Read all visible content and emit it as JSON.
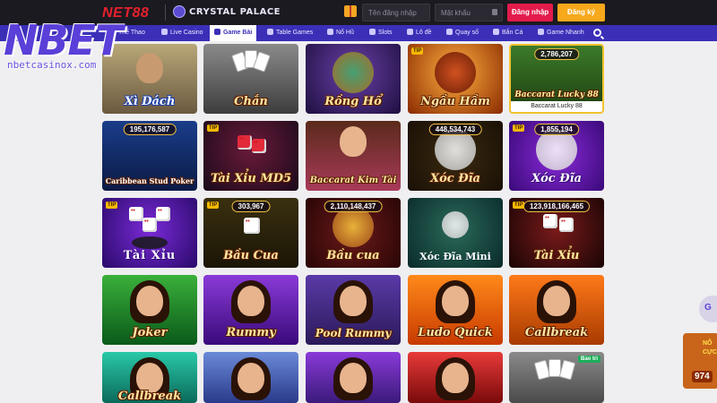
{
  "header": {
    "logo": "NET88",
    "brand": "CRYSTAL PALACE",
    "username_placeholder": "Tên đăng nhập",
    "password_placeholder": "Mật khẩu",
    "login_label": "Đăng nhập",
    "register_label": "Đăng ký"
  },
  "nav": {
    "items": [
      {
        "label": "Thể Thao",
        "icon": "ball-icon"
      },
      {
        "label": "Live Casino",
        "icon": "dealer-icon"
      },
      {
        "label": "Game Bài",
        "icon": "cards-icon",
        "active": true
      },
      {
        "label": "Table Games",
        "icon": "table-icon"
      },
      {
        "label": "Nổ Hũ",
        "icon": "jackpot-icon"
      },
      {
        "label": "Slots",
        "icon": "slot-icon"
      },
      {
        "label": "Lô đề",
        "icon": "lottery-icon"
      },
      {
        "label": "Quay số",
        "icon": "wheel-icon"
      },
      {
        "label": "Bắn Cá",
        "icon": "fish-icon"
      },
      {
        "label": "Game Nhanh",
        "icon": "rocket-icon"
      }
    ]
  },
  "watermark": {
    "main": "NBET",
    "sub": "nbetcasinox.com"
  },
  "games": [
    {
      "title": "Xì Dách"
    },
    {
      "title": "Chắn"
    },
    {
      "title": "Rồng Hổ"
    },
    {
      "title": "Ngầu Hầm",
      "badge": "TIP"
    },
    {
      "title": "Baccarat Lucky 88",
      "counter": "2,786,207",
      "subtitle": "Baccarat Lucky 88"
    },
    {
      "title": "Caribbean Stud Poker",
      "counter": "195,176,587"
    },
    {
      "title": "Tài Xỉu MD5",
      "badge": "TIP"
    },
    {
      "title": "Baccarat Kim Tài"
    },
    {
      "title": "Xóc Đĩa",
      "counter": "448,534,743"
    },
    {
      "title": "Xóc Đĩa",
      "counter": "1,855,194",
      "badge": "TIP"
    },
    {
      "title": "Tài Xỉu",
      "badge": "TIP"
    },
    {
      "title": "Bầu Cua",
      "counter": "303,967",
      "badge": "TIP"
    },
    {
      "title": "Bầu cua",
      "counter": "2,110,148,437"
    },
    {
      "title": "Xóc Đĩa Mini"
    },
    {
      "title": "Tài Xỉu",
      "counter": "123,918,166,465",
      "badge": "TIP"
    },
    {
      "title": "Joker"
    },
    {
      "title": "Rummy"
    },
    {
      "title": "Pool Rummy"
    },
    {
      "title": "Ludo Quick"
    },
    {
      "title": "Callbreak"
    },
    {
      "title": "Callbreak"
    },
    {
      "title": ""
    },
    {
      "title": ""
    },
    {
      "title": ""
    },
    {
      "title": "",
      "badge_r": "Bảo trì"
    }
  ],
  "promo": {
    "g": "G",
    "line1": "NỔ",
    "line2": "CỰC",
    "number": "974"
  },
  "colors": {
    "header_bg": "#1b1a20",
    "nav_bg": "#3b2fb8",
    "login": "#e31b4b",
    "register": "#f7a81b",
    "page_bg": "#efeff1"
  }
}
